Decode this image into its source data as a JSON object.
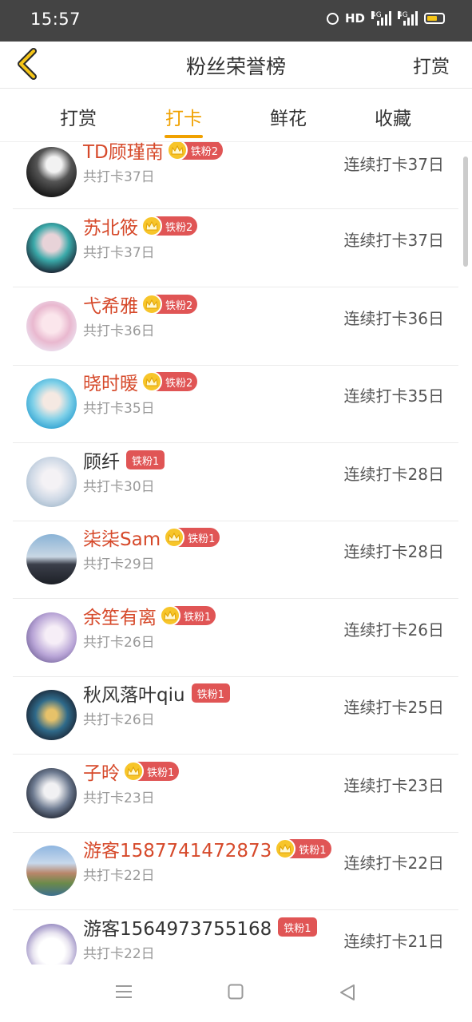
{
  "status_bar": {
    "time": "15:57",
    "hd": "HD",
    "net1": "4G",
    "net2": "4G"
  },
  "header": {
    "title": "粉丝荣誉榜",
    "action": "打赏"
  },
  "tabs": [
    {
      "label": "打赏",
      "active": false
    },
    {
      "label": "打卡",
      "active": true
    },
    {
      "label": "鲜花",
      "active": false
    },
    {
      "label": "收藏",
      "active": false
    }
  ],
  "colors": {
    "accent": "#f0a100",
    "highlight_name": "#d6492a",
    "badge": "#e05555",
    "crown": "#f7c52a"
  },
  "fans": [
    {
      "name": "TD顾瑾南",
      "badge": "铁粉2",
      "crown": true,
      "highlight": true,
      "total": "共打卡37日",
      "streak": "连续打卡37日"
    },
    {
      "name": "苏北筱",
      "badge": "铁粉2",
      "crown": true,
      "highlight": true,
      "total": "共打卡37日",
      "streak": "连续打卡37日"
    },
    {
      "name": "弋希雅",
      "badge": "铁粉2",
      "crown": true,
      "highlight": true,
      "total": "共打卡36日",
      "streak": "连续打卡36日"
    },
    {
      "name": "晓时暖",
      "badge": "铁粉2",
      "crown": true,
      "highlight": true,
      "total": "共打卡35日",
      "streak": "连续打卡35日"
    },
    {
      "name": "顾纤",
      "badge": "铁粉1",
      "crown": false,
      "highlight": false,
      "total": "共打卡30日",
      "streak": "连续打卡28日"
    },
    {
      "name": "柒柒Sam",
      "badge": "铁粉1",
      "crown": true,
      "highlight": true,
      "total": "共打卡29日",
      "streak": "连续打卡28日"
    },
    {
      "name": "余笙有离",
      "badge": "铁粉1",
      "crown": true,
      "highlight": true,
      "total": "共打卡26日",
      "streak": "连续打卡26日"
    },
    {
      "name": "秋风落叶qiu",
      "badge": "铁粉1",
      "crown": false,
      "highlight": false,
      "total": "共打卡26日",
      "streak": "连续打卡25日"
    },
    {
      "name": "子昤",
      "badge": "铁粉1",
      "crown": true,
      "highlight": true,
      "total": "共打卡23日",
      "streak": "连续打卡23日"
    },
    {
      "name": "游客1587741472873",
      "badge": "铁粉1",
      "crown": true,
      "highlight": true,
      "total": "共打卡22日",
      "streak": "连续打卡22日"
    },
    {
      "name": "游客1564973755168",
      "badge": "铁粉1",
      "crown": false,
      "highlight": false,
      "total": "共打卡22日",
      "streak": "连续打卡21日"
    }
  ],
  "nav_icons": [
    "menu-icon",
    "home-square-icon",
    "back-triangle-icon"
  ]
}
